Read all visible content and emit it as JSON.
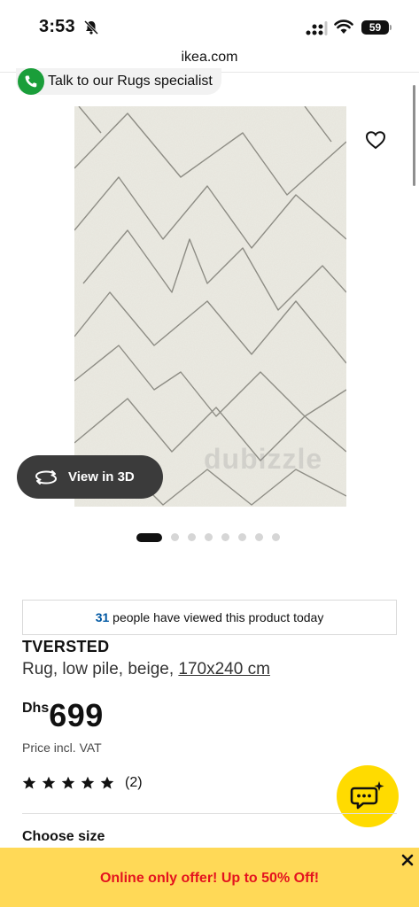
{
  "status_bar": {
    "time": "3:53",
    "battery": "59",
    "icons": [
      "bell-slash-icon",
      "signal-icon",
      "wifi-icon",
      "battery-icon"
    ]
  },
  "browser": {
    "url": "ikea.com"
  },
  "talk_pill": {
    "label": "Talk to our Rugs specialist",
    "icon": "phone-icon",
    "color": "#1a9e3a"
  },
  "gallery": {
    "watermark": "dubizzle",
    "view3d_label": "View in 3D",
    "total_images": 8,
    "active_image": 1
  },
  "viewed": {
    "count": "31",
    "text": " people have viewed this product today"
  },
  "product": {
    "name": "TVERSTED",
    "description": "Rug, low pile, beige, ",
    "size": "170x240 cm",
    "currency": "Dhs",
    "price": "699",
    "vat_note": "Price incl. VAT",
    "rating_stars": 5,
    "reviews": "(2)"
  },
  "sections": {
    "choose_size": "Choose size"
  },
  "offer": {
    "text": "Online only offer! Up to 50% Off!",
    "background": "#ffd957",
    "text_color": "#e4131f"
  },
  "colors": {
    "accent_blue": "#0058a3",
    "chat_yellow": "#ffdb00"
  }
}
